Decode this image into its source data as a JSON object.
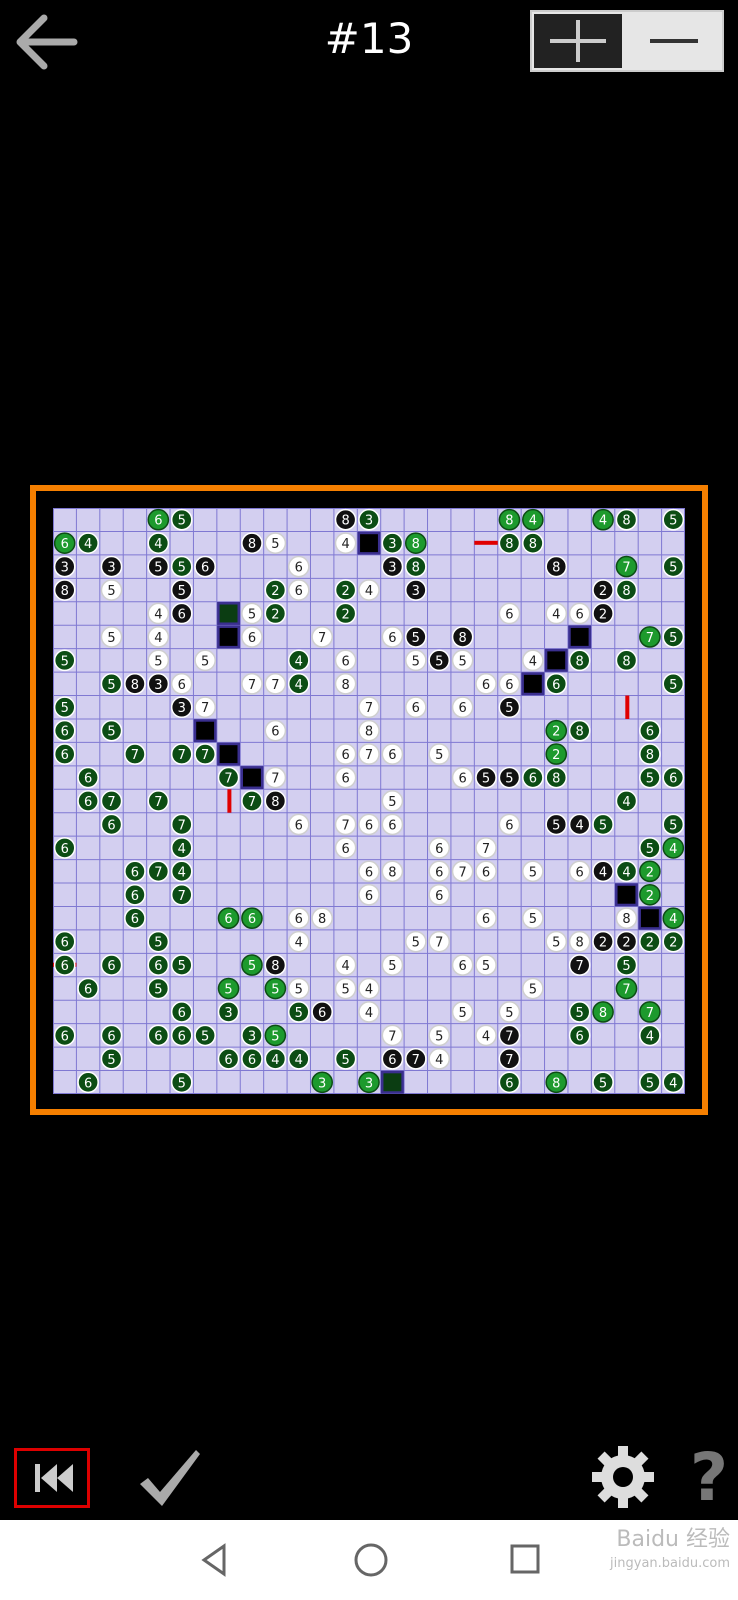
{
  "header": {
    "title": "#13",
    "back_icon": "arrow-left-icon",
    "zoom_in_icon": "plus-icon",
    "zoom_out_icon": "minus-icon"
  },
  "colors": {
    "frame": "#f57f00",
    "grid_bg": "#d3cff0",
    "grid_line": "#7f78d2",
    "dark_green": "#0c4d14",
    "light_green": "#1d9a2d",
    "black_circle": "#111111",
    "red_mark": "#e00000"
  },
  "board": {
    "rows": 25,
    "cols": 27,
    "clues": [
      [
        0,
        4,
        "6",
        "lg"
      ],
      [
        0,
        5,
        "5",
        "dg"
      ],
      [
        0,
        12,
        "8",
        "bk"
      ],
      [
        0,
        13,
        "3",
        "dg"
      ],
      [
        0,
        19,
        "8",
        "lg"
      ],
      [
        0,
        20,
        "4",
        "lg"
      ],
      [
        0,
        23,
        "4",
        "lg"
      ],
      [
        0,
        24,
        "8",
        "dg"
      ],
      [
        0,
        26,
        "5",
        "dg"
      ],
      [
        1,
        0,
        "6",
        "lg"
      ],
      [
        1,
        1,
        "4",
        "dg"
      ],
      [
        1,
        4,
        "4",
        "dg"
      ],
      [
        1,
        8,
        "8",
        "bk"
      ],
      [
        1,
        9,
        "5",
        "wh"
      ],
      [
        1,
        12,
        "4",
        "wh"
      ],
      [
        1,
        14,
        "3",
        "dg"
      ],
      [
        1,
        15,
        "8",
        "lg"
      ],
      [
        1,
        19,
        "8",
        "dg"
      ],
      [
        1,
        20,
        "8",
        "dg"
      ],
      [
        2,
        0,
        "3",
        "bk"
      ],
      [
        2,
        2,
        "3",
        "bk"
      ],
      [
        2,
        4,
        "5",
        "bk"
      ],
      [
        2,
        5,
        "5",
        "dg"
      ],
      [
        2,
        6,
        "6",
        "bk"
      ],
      [
        2,
        10,
        "6",
        "wh"
      ],
      [
        2,
        14,
        "3",
        "bk"
      ],
      [
        2,
        15,
        "8",
        "dg"
      ],
      [
        2,
        21,
        "8",
        "bk"
      ],
      [
        2,
        24,
        "7",
        "lg"
      ],
      [
        2,
        26,
        "5",
        "dg"
      ],
      [
        3,
        0,
        "8",
        "bk"
      ],
      [
        3,
        2,
        "5",
        "wh"
      ],
      [
        3,
        5,
        "5",
        "bk"
      ],
      [
        3,
        9,
        "2",
        "dg"
      ],
      [
        3,
        10,
        "6",
        "wh"
      ],
      [
        3,
        12,
        "2",
        "dg"
      ],
      [
        3,
        13,
        "4",
        "wh"
      ],
      [
        3,
        15,
        "3",
        "bk"
      ],
      [
        3,
        23,
        "2",
        "bk"
      ],
      [
        3,
        24,
        "8",
        "dg"
      ],
      [
        4,
        4,
        "4",
        "wh"
      ],
      [
        4,
        5,
        "6",
        "bk"
      ],
      [
        4,
        8,
        "5",
        "wh"
      ],
      [
        4,
        9,
        "2",
        "dg"
      ],
      [
        4,
        12,
        "2",
        "dg"
      ],
      [
        4,
        19,
        "6",
        "wh"
      ],
      [
        4,
        21,
        "4",
        "wh"
      ],
      [
        4,
        22,
        "6",
        "wh"
      ],
      [
        4,
        23,
        "2",
        "bk"
      ],
      [
        5,
        2,
        "5",
        "wh"
      ],
      [
        5,
        4,
        "4",
        "wh"
      ],
      [
        5,
        8,
        "6",
        "wh"
      ],
      [
        5,
        11,
        "7",
        "wh"
      ],
      [
        5,
        14,
        "6",
        "wh"
      ],
      [
        5,
        15,
        "5",
        "bk"
      ],
      [
        5,
        17,
        "8",
        "bk"
      ],
      [
        5,
        25,
        "7",
        "lg"
      ],
      [
        5,
        26,
        "5",
        "dg"
      ],
      [
        6,
        0,
        "5",
        "dg"
      ],
      [
        6,
        4,
        "5",
        "wh"
      ],
      [
        6,
        6,
        "5",
        "wh"
      ],
      [
        6,
        10,
        "4",
        "dg"
      ],
      [
        6,
        12,
        "6",
        "wh"
      ],
      [
        6,
        15,
        "5",
        "wh"
      ],
      [
        6,
        16,
        "5",
        "bk"
      ],
      [
        6,
        17,
        "5",
        "wh"
      ],
      [
        6,
        20,
        "4",
        "wh"
      ],
      [
        6,
        22,
        "8",
        "dg"
      ],
      [
        6,
        24,
        "8",
        "dg"
      ],
      [
        7,
        2,
        "5",
        "dg"
      ],
      [
        7,
        3,
        "8",
        "bk"
      ],
      [
        7,
        4,
        "3",
        "bk"
      ],
      [
        7,
        5,
        "6",
        "wh"
      ],
      [
        7,
        8,
        "7",
        "wh"
      ],
      [
        7,
        9,
        "7",
        "wh"
      ],
      [
        7,
        10,
        "4",
        "dg"
      ],
      [
        7,
        12,
        "8",
        "wh"
      ],
      [
        7,
        18,
        "6",
        "wh"
      ],
      [
        7,
        19,
        "6",
        "wh"
      ],
      [
        7,
        21,
        "6",
        "dg"
      ],
      [
        7,
        26,
        "5",
        "dg"
      ],
      [
        8,
        0,
        "5",
        "dg"
      ],
      [
        8,
        5,
        "3",
        "bk"
      ],
      [
        8,
        6,
        "7",
        "wh"
      ],
      [
        8,
        13,
        "7",
        "wh"
      ],
      [
        8,
        15,
        "6",
        "wh"
      ],
      [
        8,
        17,
        "6",
        "wh"
      ],
      [
        8,
        19,
        "5",
        "bk"
      ],
      [
        9,
        0,
        "6",
        "dg"
      ],
      [
        9,
        2,
        "5",
        "dg"
      ],
      [
        9,
        9,
        "6",
        "wh"
      ],
      [
        9,
        13,
        "8",
        "wh"
      ],
      [
        9,
        21,
        "2",
        "lg"
      ],
      [
        9,
        22,
        "8",
        "dg"
      ],
      [
        9,
        25,
        "6",
        "dg"
      ],
      [
        10,
        0,
        "6",
        "dg"
      ],
      [
        10,
        3,
        "7",
        "dg"
      ],
      [
        10,
        5,
        "7",
        "dg"
      ],
      [
        10,
        6,
        "7",
        "dg"
      ],
      [
        10,
        12,
        "6",
        "wh"
      ],
      [
        10,
        13,
        "7",
        "wh"
      ],
      [
        10,
        14,
        "6",
        "wh"
      ],
      [
        10,
        16,
        "5",
        "wh"
      ],
      [
        10,
        21,
        "2",
        "lg"
      ],
      [
        10,
        25,
        "8",
        "dg"
      ],
      [
        11,
        1,
        "6",
        "dg"
      ],
      [
        11,
        7,
        "7",
        "dg"
      ],
      [
        11,
        9,
        "7",
        "wh"
      ],
      [
        11,
        12,
        "6",
        "wh"
      ],
      [
        11,
        17,
        "6",
        "wh"
      ],
      [
        11,
        18,
        "5",
        "bk"
      ],
      [
        11,
        19,
        "5",
        "bk"
      ],
      [
        11,
        20,
        "6",
        "dg"
      ],
      [
        11,
        21,
        "8",
        "dg"
      ],
      [
        11,
        25,
        "5",
        "dg"
      ],
      [
        11,
        26,
        "6",
        "dg"
      ],
      [
        12,
        1,
        "6",
        "dg"
      ],
      [
        12,
        2,
        "7",
        "dg"
      ],
      [
        12,
        4,
        "7",
        "dg"
      ],
      [
        12,
        8,
        "7",
        "dg"
      ],
      [
        12,
        9,
        "8",
        "bk"
      ],
      [
        12,
        14,
        "5",
        "wh"
      ],
      [
        12,
        24,
        "4",
        "dg"
      ],
      [
        13,
        2,
        "6",
        "dg"
      ],
      [
        13,
        5,
        "7",
        "dg"
      ],
      [
        13,
        10,
        "6",
        "wh"
      ],
      [
        13,
        12,
        "7",
        "wh"
      ],
      [
        13,
        13,
        "6",
        "wh"
      ],
      [
        13,
        14,
        "6",
        "wh"
      ],
      [
        13,
        19,
        "6",
        "wh"
      ],
      [
        13,
        21,
        "5",
        "bk"
      ],
      [
        13,
        22,
        "4",
        "bk"
      ],
      [
        13,
        23,
        "5",
        "dg"
      ],
      [
        13,
        26,
        "5",
        "dg"
      ],
      [
        14,
        0,
        "6",
        "dg"
      ],
      [
        14,
        5,
        "4",
        "dg"
      ],
      [
        14,
        12,
        "6",
        "wh"
      ],
      [
        14,
        16,
        "6",
        "wh"
      ],
      [
        14,
        18,
        "7",
        "wh"
      ],
      [
        14,
        25,
        "5",
        "dg"
      ],
      [
        14,
        26,
        "4",
        "lg"
      ],
      [
        15,
        3,
        "6",
        "dg"
      ],
      [
        15,
        4,
        "7",
        "dg"
      ],
      [
        15,
        5,
        "4",
        "dg"
      ],
      [
        15,
        13,
        "6",
        "wh"
      ],
      [
        15,
        14,
        "8",
        "wh"
      ],
      [
        15,
        16,
        "6",
        "wh"
      ],
      [
        15,
        17,
        "7",
        "wh"
      ],
      [
        15,
        18,
        "6",
        "wh"
      ],
      [
        15,
        20,
        "5",
        "wh"
      ],
      [
        15,
        22,
        "6",
        "wh"
      ],
      [
        15,
        23,
        "4",
        "bk"
      ],
      [
        15,
        24,
        "4",
        "dg"
      ],
      [
        15,
        25,
        "2",
        "lg"
      ],
      [
        16,
        3,
        "6",
        "dg"
      ],
      [
        16,
        5,
        "7",
        "dg"
      ],
      [
        16,
        13,
        "6",
        "wh"
      ],
      [
        16,
        16,
        "6",
        "wh"
      ],
      [
        16,
        25,
        "2",
        "lg"
      ],
      [
        17,
        3,
        "6",
        "dg"
      ],
      [
        17,
        7,
        "6",
        "lg"
      ],
      [
        17,
        8,
        "6",
        "lg"
      ],
      [
        17,
        10,
        "6",
        "wh"
      ],
      [
        17,
        11,
        "8",
        "wh"
      ],
      [
        17,
        18,
        "6",
        "wh"
      ],
      [
        17,
        20,
        "5",
        "wh"
      ],
      [
        17,
        24,
        "8",
        "wh"
      ],
      [
        17,
        26,
        "4",
        "lg"
      ],
      [
        18,
        0,
        "6",
        "dg"
      ],
      [
        18,
        4,
        "5",
        "dg"
      ],
      [
        18,
        10,
        "4",
        "wh"
      ],
      [
        18,
        15,
        "5",
        "wh"
      ],
      [
        18,
        16,
        "7",
        "wh"
      ],
      [
        18,
        21,
        "5",
        "wh"
      ],
      [
        18,
        22,
        "8",
        "wh"
      ],
      [
        18,
        23,
        "2",
        "bk"
      ],
      [
        18,
        24,
        "2",
        "bk"
      ],
      [
        18,
        25,
        "2",
        "dg"
      ],
      [
        18,
        26,
        "2",
        "dg"
      ],
      [
        19,
        0,
        "6",
        "dg"
      ],
      [
        19,
        2,
        "6",
        "dg"
      ],
      [
        19,
        4,
        "6",
        "dg"
      ],
      [
        19,
        5,
        "5",
        "dg"
      ],
      [
        19,
        8,
        "5",
        "lg"
      ],
      [
        19,
        9,
        "8",
        "bk"
      ],
      [
        19,
        12,
        "4",
        "wh"
      ],
      [
        19,
        14,
        "5",
        "wh"
      ],
      [
        19,
        17,
        "6",
        "wh"
      ],
      [
        19,
        18,
        "5",
        "wh"
      ],
      [
        19,
        22,
        "7",
        "bk"
      ],
      [
        19,
        24,
        "5",
        "dg"
      ],
      [
        20,
        1,
        "6",
        "dg"
      ],
      [
        20,
        4,
        "5",
        "dg"
      ],
      [
        20,
        7,
        "5",
        "lg"
      ],
      [
        20,
        9,
        "5",
        "lg"
      ],
      [
        20,
        10,
        "5",
        "wh"
      ],
      [
        20,
        12,
        "5",
        "wh"
      ],
      [
        20,
        13,
        "4",
        "wh"
      ],
      [
        20,
        20,
        "5",
        "wh"
      ],
      [
        20,
        24,
        "7",
        "lg"
      ],
      [
        21,
        5,
        "6",
        "dg"
      ],
      [
        21,
        7,
        "3",
        "dg"
      ],
      [
        21,
        10,
        "5",
        "dg"
      ],
      [
        21,
        11,
        "6",
        "bk"
      ],
      [
        21,
        13,
        "4",
        "wh"
      ],
      [
        21,
        17,
        "5",
        "wh"
      ],
      [
        21,
        19,
        "5",
        "wh"
      ],
      [
        21,
        22,
        "5",
        "dg"
      ],
      [
        21,
        23,
        "8",
        "lg"
      ],
      [
        21,
        25,
        "7",
        "lg"
      ],
      [
        22,
        0,
        "6",
        "dg"
      ],
      [
        22,
        2,
        "6",
        "dg"
      ],
      [
        22,
        4,
        "6",
        "dg"
      ],
      [
        22,
        5,
        "6",
        "dg"
      ],
      [
        22,
        6,
        "5",
        "dg"
      ],
      [
        22,
        8,
        "3",
        "dg"
      ],
      [
        22,
        9,
        "5",
        "lg"
      ],
      [
        22,
        14,
        "7",
        "wh"
      ],
      [
        22,
        16,
        "5",
        "wh"
      ],
      [
        22,
        18,
        "4",
        "wh"
      ],
      [
        22,
        19,
        "7",
        "bk"
      ],
      [
        22,
        22,
        "6",
        "dg"
      ],
      [
        22,
        25,
        "4",
        "dg"
      ],
      [
        23,
        2,
        "5",
        "dg"
      ],
      [
        23,
        7,
        "6",
        "dg"
      ],
      [
        23,
        8,
        "6",
        "dg"
      ],
      [
        23,
        9,
        "4",
        "dg"
      ],
      [
        23,
        10,
        "4",
        "dg"
      ],
      [
        23,
        12,
        "5",
        "dg"
      ],
      [
        23,
        14,
        "6",
        "bk"
      ],
      [
        23,
        15,
        "7",
        "bk"
      ],
      [
        23,
        16,
        "4",
        "wh"
      ],
      [
        23,
        19,
        "7",
        "bk"
      ],
      [
        24,
        1,
        "6",
        "dg"
      ],
      [
        24,
        5,
        "5",
        "dg"
      ],
      [
        24,
        11,
        "3",
        "lg"
      ],
      [
        24,
        13,
        "3",
        "lg"
      ],
      [
        24,
        19,
        "6",
        "dg"
      ],
      [
        24,
        21,
        "8",
        "lg"
      ],
      [
        24,
        23,
        "5",
        "dg"
      ],
      [
        24,
        25,
        "5",
        "dg"
      ],
      [
        24,
        26,
        "4",
        "dg"
      ]
    ],
    "dark_squares": [
      [
        1,
        13
      ],
      [
        4,
        7
      ],
      [
        5,
        7
      ],
      [
        5,
        22
      ],
      [
        6,
        21
      ],
      [
        7,
        20
      ],
      [
        9,
        6
      ],
      [
        10,
        7
      ],
      [
        11,
        8
      ],
      [
        16,
        24
      ],
      [
        17,
        25
      ]
    ],
    "green_squares": [
      [
        4,
        7
      ],
      [
        24,
        14
      ]
    ],
    "red_marks": [
      [
        1,
        18,
        "h"
      ],
      [
        8,
        24,
        "v"
      ],
      [
        12,
        7,
        "v"
      ],
      [
        19,
        0,
        "h"
      ]
    ]
  },
  "footer": {
    "rewind_icon": "rewind-icon",
    "check_icon": "checkmark-icon",
    "settings_icon": "gear-icon",
    "help_label": "?"
  },
  "navbar": {
    "back_icon": "nav-back-icon",
    "home_icon": "nav-home-icon",
    "recent_icon": "nav-recent-icon"
  },
  "watermark": {
    "line1": "Baidu 经验",
    "line2": "jingyan.baidu.com"
  }
}
